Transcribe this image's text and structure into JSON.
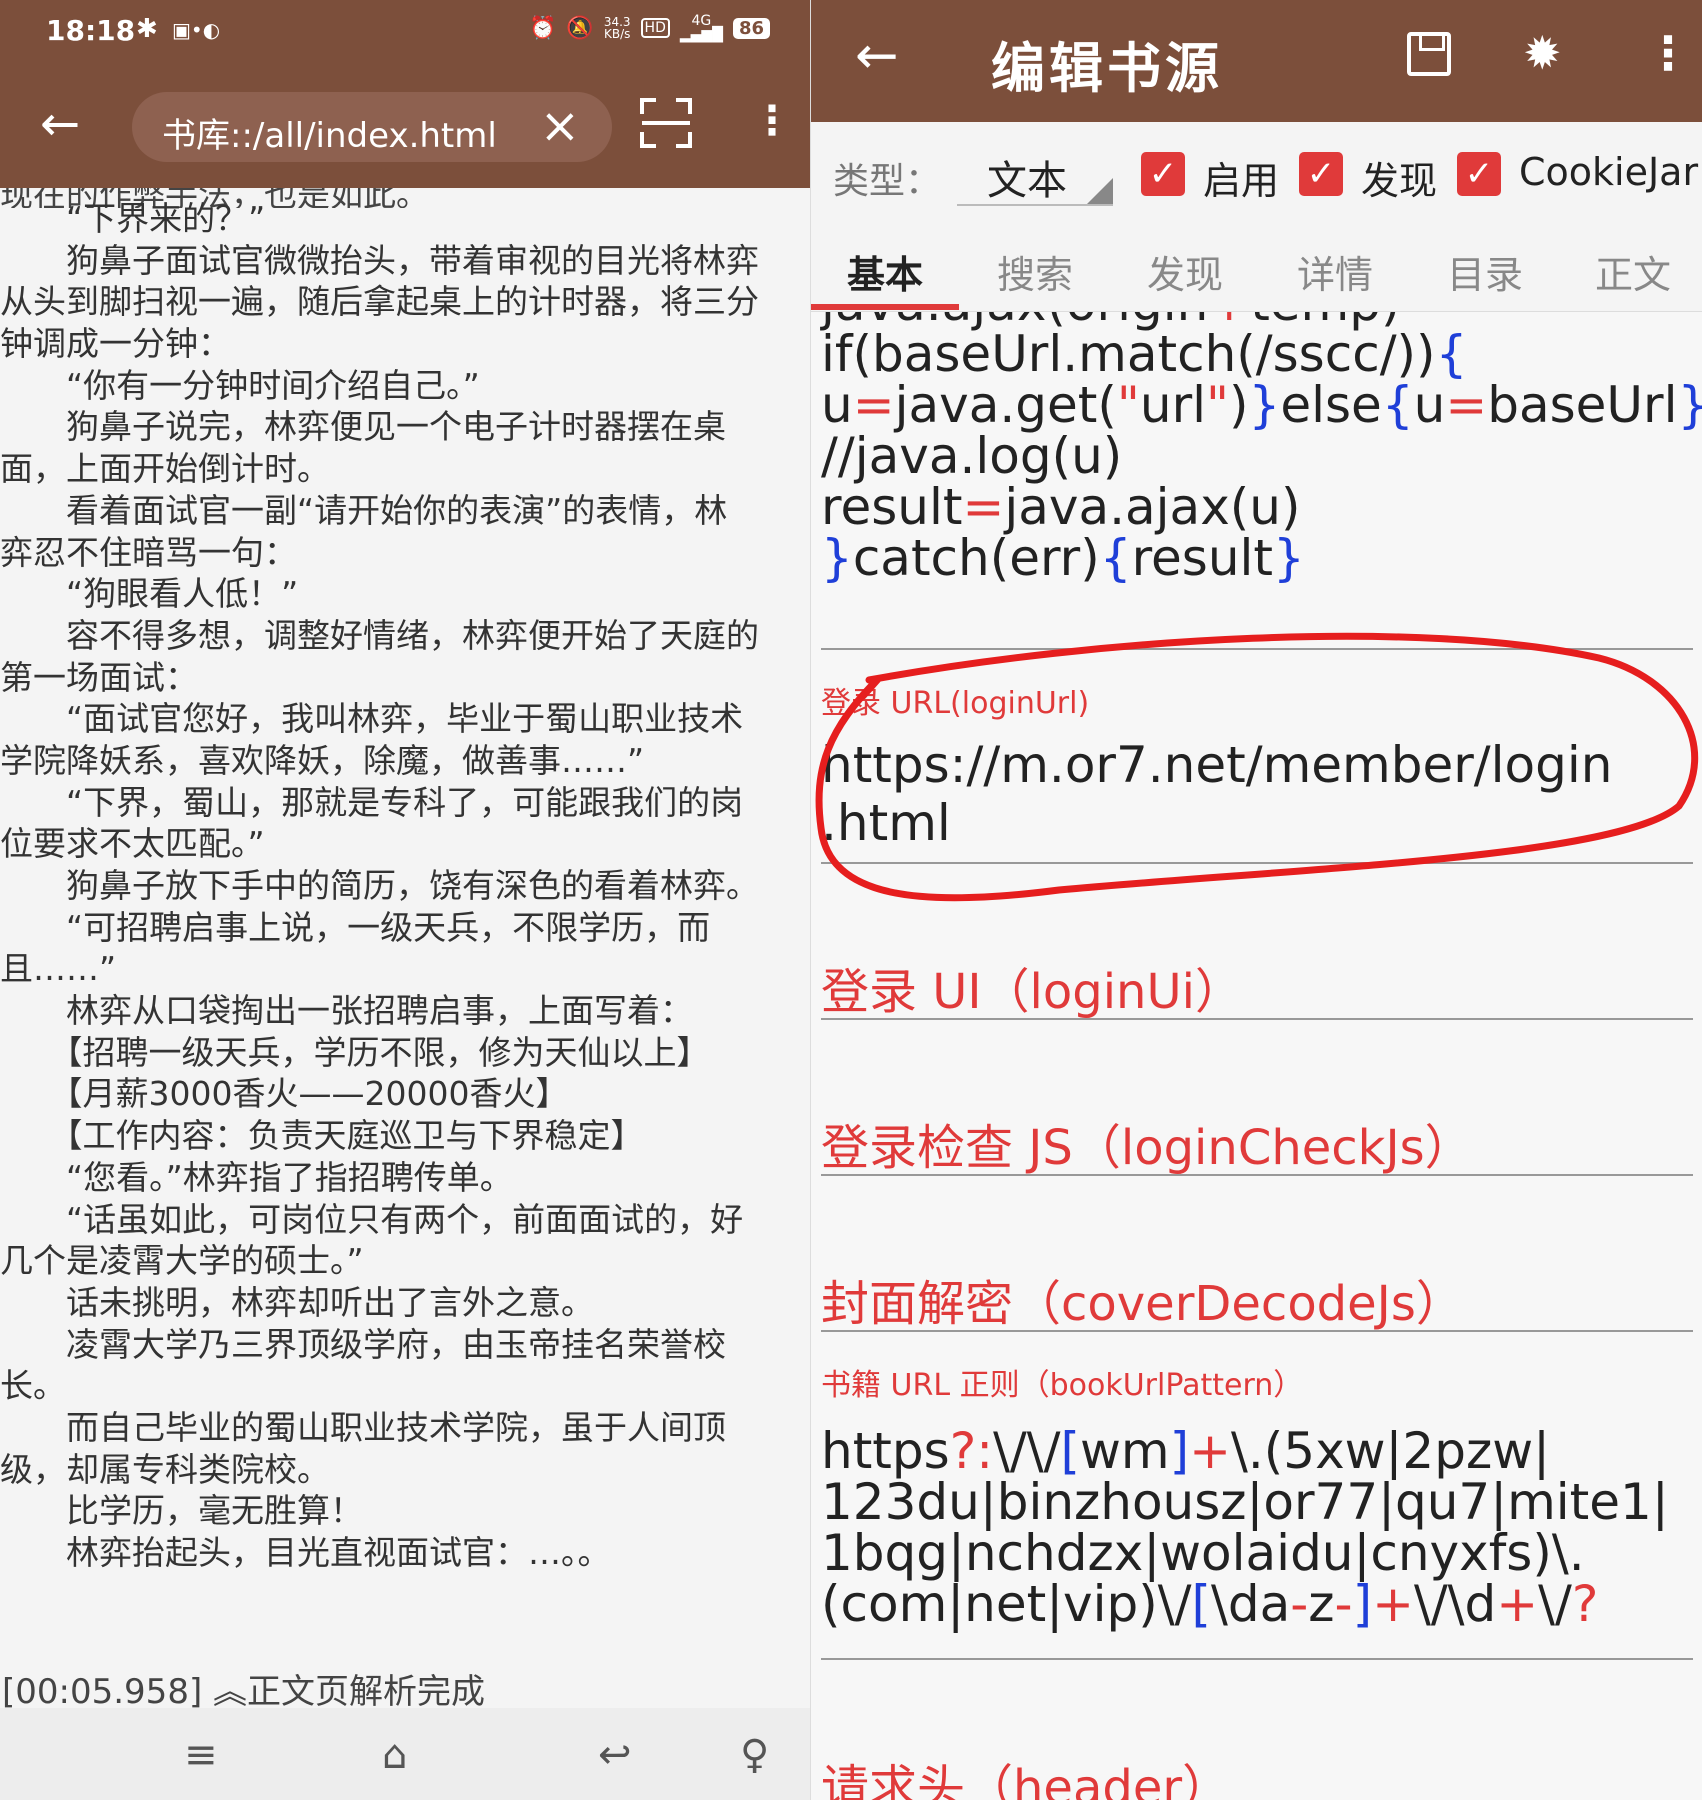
{
  "left": {
    "status": {
      "time": "18:18",
      "net_speed_value": "34.3",
      "net_speed_unit": "KB/s",
      "hd": "HD",
      "network": "4G",
      "battery": "86"
    },
    "browser": {
      "url": "书库::/all/index.html"
    },
    "reader": {
      "clipped_top": "现在的作弊手法，也是如此。",
      "lines": [
        "　　“下界来的？”",
        "　　狗鼻子面试官微微抬头，带着审视的目光将林弈",
        "从头到脚扫视一遍，随后拿起桌上的计时器，将三分",
        "钟调成一分钟：",
        "　　“你有一分钟时间介绍自己。”",
        "　　狗鼻子说完，林弈便见一个电子计时器摆在桌",
        "面，上面开始倒计时。",
        "　　看着面试官一副“请开始你的表演”的表情，林",
        "弈忍不住暗骂一句：",
        "　　“狗眼看人低！”",
        "　　容不得多想，调整好情绪，林弈便开始了天庭的",
        "第一场面试：",
        "　　“面试官您好，我叫林弈，毕业于蜀山职业技术",
        "学院降妖系，喜欢降妖，除魔，做善事……”",
        "　　“下界，蜀山，那就是专科了，可能跟我们的岗",
        "位要求不太匹配。”",
        "　　狗鼻子放下手中的简历，饶有深色的看着林弈。",
        "　　“可招聘启事上说，一级天兵，不限学历，而",
        "且……”",
        "　　林弈从口袋掏出一张招聘启事，上面写着：",
        "　　【招聘一级天兵，学历不限，修为天仙以上】",
        "　　【月薪3000香火——20000香火】",
        "　　【工作内容：负责天庭巡卫与下界稳定】",
        "　　“您看。”林弈指了指招聘传单。",
        "　　“话虽如此，可岗位只有两个，前面面试的，好",
        "几个是凌霄大学的硕士。”",
        "　　话未挑明，林弈却听出了言外之意。",
        "　　凌霄大学乃三界顶级学府，由玉帝挂名荣誉校",
        "长。",
        "　　而自己毕业的蜀山职业技术学院，虽于人间顶",
        "级，却属专科类院校。",
        "　　比学历，毫无胜算！",
        "　　林弈抬起头，目光直视面试官：…。。"
      ]
    },
    "log": "[00:05.958] ︽正文页解析完成"
  },
  "right": {
    "title": "编辑书源",
    "type_label": "类型：",
    "type_value": "文本",
    "checkboxes": [
      "启用",
      "发现",
      "CookieJar"
    ],
    "tabs": [
      "基本",
      "搜索",
      "发现",
      "详情",
      "目录",
      "正文"
    ],
    "code_lines": [
      {
        "parts": [
          [
            "t",
            " java.ajax(origin"
          ],
          [
            "op",
            "+"
          ],
          [
            "t",
            "temp)"
          ]
        ]
      },
      {
        "parts": [
          [
            "t",
            "if(baseUrl.match(/sscc/))"
          ],
          [
            "br",
            "{"
          ]
        ]
      },
      {
        "parts": [
          [
            "t",
            " u"
          ],
          [
            "op",
            "="
          ],
          [
            "t",
            "java.get("
          ],
          [
            "op",
            "\""
          ],
          [
            "t",
            "url"
          ],
          [
            "op",
            "\""
          ],
          [
            "t",
            ")"
          ],
          [
            "br",
            "}"
          ],
          [
            "t",
            "else"
          ],
          [
            "br",
            "{"
          ],
          [
            "t",
            "u"
          ],
          [
            "op",
            "="
          ],
          [
            "t",
            "baseUrl"
          ],
          [
            "br",
            "}"
          ]
        ]
      },
      {
        "parts": [
          [
            "t",
            " //java.log(u)"
          ]
        ]
      },
      {
        "parts": [
          [
            "t",
            " result"
          ],
          [
            "op",
            "="
          ],
          [
            "t",
            "java.ajax(u)"
          ]
        ]
      },
      {
        "parts": [
          [
            "br",
            "}"
          ],
          [
            "t",
            "catch(err)"
          ],
          [
            "br",
            "{"
          ],
          [
            "t",
            "result"
          ],
          [
            "br",
            "}"
          ]
        ]
      }
    ],
    "login_url_label": "登录 URL(loginUrl)",
    "login_url_value": "https://m.or7.net/member/login\n.html",
    "login_ui_label": "登录 UI（loginUi）",
    "login_check_label": "登录检查 JS（loginCheckJs）",
    "cover_decode_label": "封面解密（coverDecodeJs）",
    "book_url_label": "书籍 URL 正则（bookUrlPattern）",
    "book_url_lines": [
      {
        "parts": [
          [
            "t",
            "https"
          ],
          [
            "op",
            "?:"
          ],
          [
            "t",
            "\\/\\/"
          ],
          [
            "br",
            "["
          ],
          [
            "t",
            "wm"
          ],
          [
            "br",
            "]"
          ],
          [
            "op",
            "+"
          ],
          [
            "t",
            "\\.(5xw|2pzw|"
          ]
        ]
      },
      {
        "parts": [
          [
            "t",
            "123du|binzhousz|or77|qu7|mite1|"
          ]
        ]
      },
      {
        "parts": [
          [
            "t",
            "1bqg|nchdzx|wolaidu|cnyxfs)\\."
          ]
        ]
      },
      {
        "parts": [
          [
            "t",
            "(com|net|vip)\\/"
          ],
          [
            "br",
            "["
          ],
          [
            "t",
            "\\da"
          ],
          [
            "op",
            "-"
          ],
          [
            "t",
            "z"
          ],
          [
            "op",
            "-"
          ],
          [
            "br",
            "]"
          ],
          [
            "op",
            "+"
          ],
          [
            "t",
            "\\/\\d"
          ],
          [
            "op",
            "+"
          ],
          [
            "t",
            "\\/"
          ],
          [
            "op",
            "?"
          ]
        ]
      }
    ],
    "header_label": "请求头（header）",
    "colors": {
      "brand": "#7c4f3b",
      "accent": "#e03a3a",
      "bracket": "#1f3fd8"
    }
  }
}
